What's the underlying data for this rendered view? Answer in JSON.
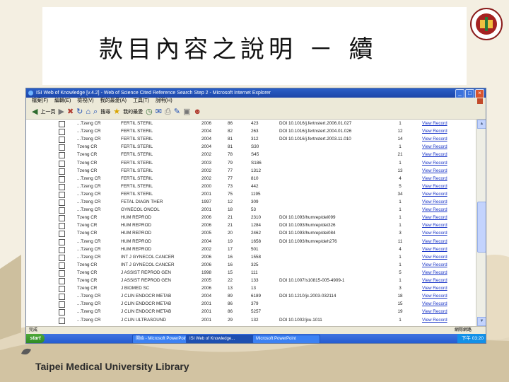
{
  "slide": {
    "title": "款目內容之說明 －  續",
    "footer": "Taipei Medical University Library"
  },
  "window": {
    "title": "ISI Web of Knowledge [v.4.2] - Web of Science Cited Reference Search Step 2 - Microsoft Internet Explorer",
    "menu": [
      "檔案(F)",
      "編輯(E)",
      "檢視(V)",
      "我的最愛(A)",
      "工具(T)",
      "說明(H)"
    ],
    "toolbar_labels": {
      "back": "上一頁",
      "search": "搜尋",
      "favorites": "我的最愛"
    },
    "status_left": "完成",
    "status_right": "網際網路"
  },
  "records": [
    {
      "author": "...Tzeng CR",
      "journal": "FERTIL STERIL",
      "year": "2006",
      "vol": "86",
      "page": "423",
      "doi": "DOI 10.1016/j.fertnstert.2006.01.027",
      "cited": "1",
      "link": "View Record"
    },
    {
      "author": "...Tzeng CR",
      "journal": "FERTIL STERIL",
      "year": "2004",
      "vol": "82",
      "page": "263",
      "doi": "DOI 10.1016/j.fertnstert.2004.01.026",
      "cited": "12",
      "link": "View Record"
    },
    {
      "author": "...Tzeng CR",
      "journal": "FERTIL STERIL",
      "year": "2004",
      "vol": "81",
      "page": "312",
      "doi": "DOI 10.1016/j.fertnstert.2003.11.010",
      "cited": "14",
      "link": "View Record"
    },
    {
      "author": "Tzeng CR",
      "journal": "FERTIL STERIL",
      "year": "2004",
      "vol": "81",
      "page": "S30",
      "doi": "",
      "cited": "1",
      "link": "View Record"
    },
    {
      "author": "Tzeng CR",
      "journal": "FERTIL STERIL",
      "year": "2002",
      "vol": "78",
      "page": "S45",
      "doi": "",
      "cited": "21",
      "link": "View Record"
    },
    {
      "author": "Tzeng CR",
      "journal": "FERTIL STERIL",
      "year": "2003",
      "vol": "79",
      "page": "S186",
      "doi": "",
      "cited": "1",
      "link": "View Record"
    },
    {
      "author": "Tzeng CR",
      "journal": "FERTIL STERIL",
      "year": "2002",
      "vol": "77",
      "page": "1312",
      "doi": "",
      "cited": "13",
      "link": "View Record"
    },
    {
      "author": "...Tzeng CR",
      "journal": "FERTIL STERIL",
      "year": "2002",
      "vol": "77",
      "page": "810",
      "doi": "",
      "cited": "4",
      "link": "View Record"
    },
    {
      "author": "...Tzeng CR",
      "journal": "FERTIL STERIL",
      "year": "2000",
      "vol": "73",
      "page": "442",
      "doi": "",
      "cited": "5",
      "link": "View Record"
    },
    {
      "author": "...Tzeng CR",
      "journal": "FERTIL STERIL",
      "year": "2001",
      "vol": "75",
      "page": "1195",
      "doi": "",
      "cited": "34",
      "link": "View Record"
    },
    {
      "author": "...Tzeng CR",
      "journal": "FETAL DIAGN THER",
      "year": "1997",
      "vol": "12",
      "page": "309",
      "doi": "",
      "cited": "1",
      "link": "View Record"
    },
    {
      "author": "...Tzeng CR",
      "journal": "GYNECOL ONCOL",
      "year": "2001",
      "vol": "18",
      "page": "53",
      "doi": "",
      "cited": "1",
      "link": "View Record"
    },
    {
      "author": "Tzeng CR",
      "journal": "HUM REPROD",
      "year": "2006",
      "vol": "21",
      "page": "2310",
      "doi": "DOI 10.1093/humrep/del099",
      "cited": "1",
      "link": "View Record"
    },
    {
      "author": "Tzeng CR",
      "journal": "HUM REPROD",
      "year": "2006",
      "vol": "21",
      "page": "1284",
      "doi": "DOI 10.1093/humrep/dei326",
      "cited": "1",
      "link": "View Record"
    },
    {
      "author": "Tzeng CR",
      "journal": "HUM REPROD",
      "year": "2005",
      "vol": "20",
      "page": "2462",
      "doi": "DOI 10.1093/humrep/dei084",
      "cited": "3",
      "link": "View Record"
    },
    {
      "author": "...Tzeng CR",
      "journal": "HUM REPROD",
      "year": "2004",
      "vol": "19",
      "page": "1658",
      "doi": "DOI 10.1093/humrep/deh276",
      "cited": "11",
      "link": "View Record"
    },
    {
      "author": "...Tzeng CR",
      "journal": "HUM REPROD",
      "year": "2002",
      "vol": "17",
      "page": "501",
      "doi": "",
      "cited": "4",
      "link": "View Record"
    },
    {
      "author": "...Tzeng CR",
      "journal": "INT J GYNECOL CANCER",
      "year": "2006",
      "vol": "16",
      "page": "1558",
      "doi": "",
      "cited": "1",
      "link": "View Record"
    },
    {
      "author": "Tzeng CR",
      "journal": "INT J GYNECOL CANCER",
      "year": "2006",
      "vol": "16",
      "page": "325",
      "doi": "",
      "cited": "1",
      "link": "View Record"
    },
    {
      "author": "Tzeng CR",
      "journal": "J ASSIST REPROD GEN",
      "year": "1998",
      "vol": "15",
      "page": "111",
      "doi": "",
      "cited": "5",
      "link": "View Record"
    },
    {
      "author": "Tzeng CR",
      "journal": "J ASSIST REPROD GEN",
      "year": "2005",
      "vol": "22",
      "page": "133",
      "doi": "DOI 10.1007/s10815-005-4909-1",
      "cited": "1",
      "link": "View Record"
    },
    {
      "author": "Tzeng CR",
      "journal": "J BIOMED SC",
      "year": "2006",
      "vol": "13",
      "page": "13",
      "doi": "",
      "cited": "3",
      "link": "View Record"
    },
    {
      "author": "...Tzeng CR",
      "journal": "J CLIN ENDOCR METAB",
      "year": "2004",
      "vol": "89",
      "page": "6189",
      "doi": "DOI 10.1210/jc.2003-032114",
      "cited": "18",
      "link": "View Record"
    },
    {
      "author": "...Tzeng CR",
      "journal": "J CLIN ENDOCR METAB",
      "year": "2001",
      "vol": "86",
      "page": "379",
      "doi": "",
      "cited": "15",
      "link": "View Record"
    },
    {
      "author": "...Tzeng CR",
      "journal": "J CLIN ENDOCR METAB",
      "year": "2001",
      "vol": "86",
      "page": "5257",
      "doi": "",
      "cited": "19",
      "link": "View Record"
    },
    {
      "author": "...Tzeng CR",
      "journal": "J CLIN ULTRASOUND",
      "year": "2001",
      "vol": "29",
      "page": "132",
      "doi": "DOI 10.1002/jcu.1011",
      "cited": "1",
      "link": "View Record"
    }
  ],
  "taskbar": {
    "start": "start",
    "tasks": [
      "開始 - Microsoft PowerPoint",
      "ISI Web of Knowledge...",
      "Microsoft PowerPoint"
    ],
    "clock": "下午 03:20"
  }
}
